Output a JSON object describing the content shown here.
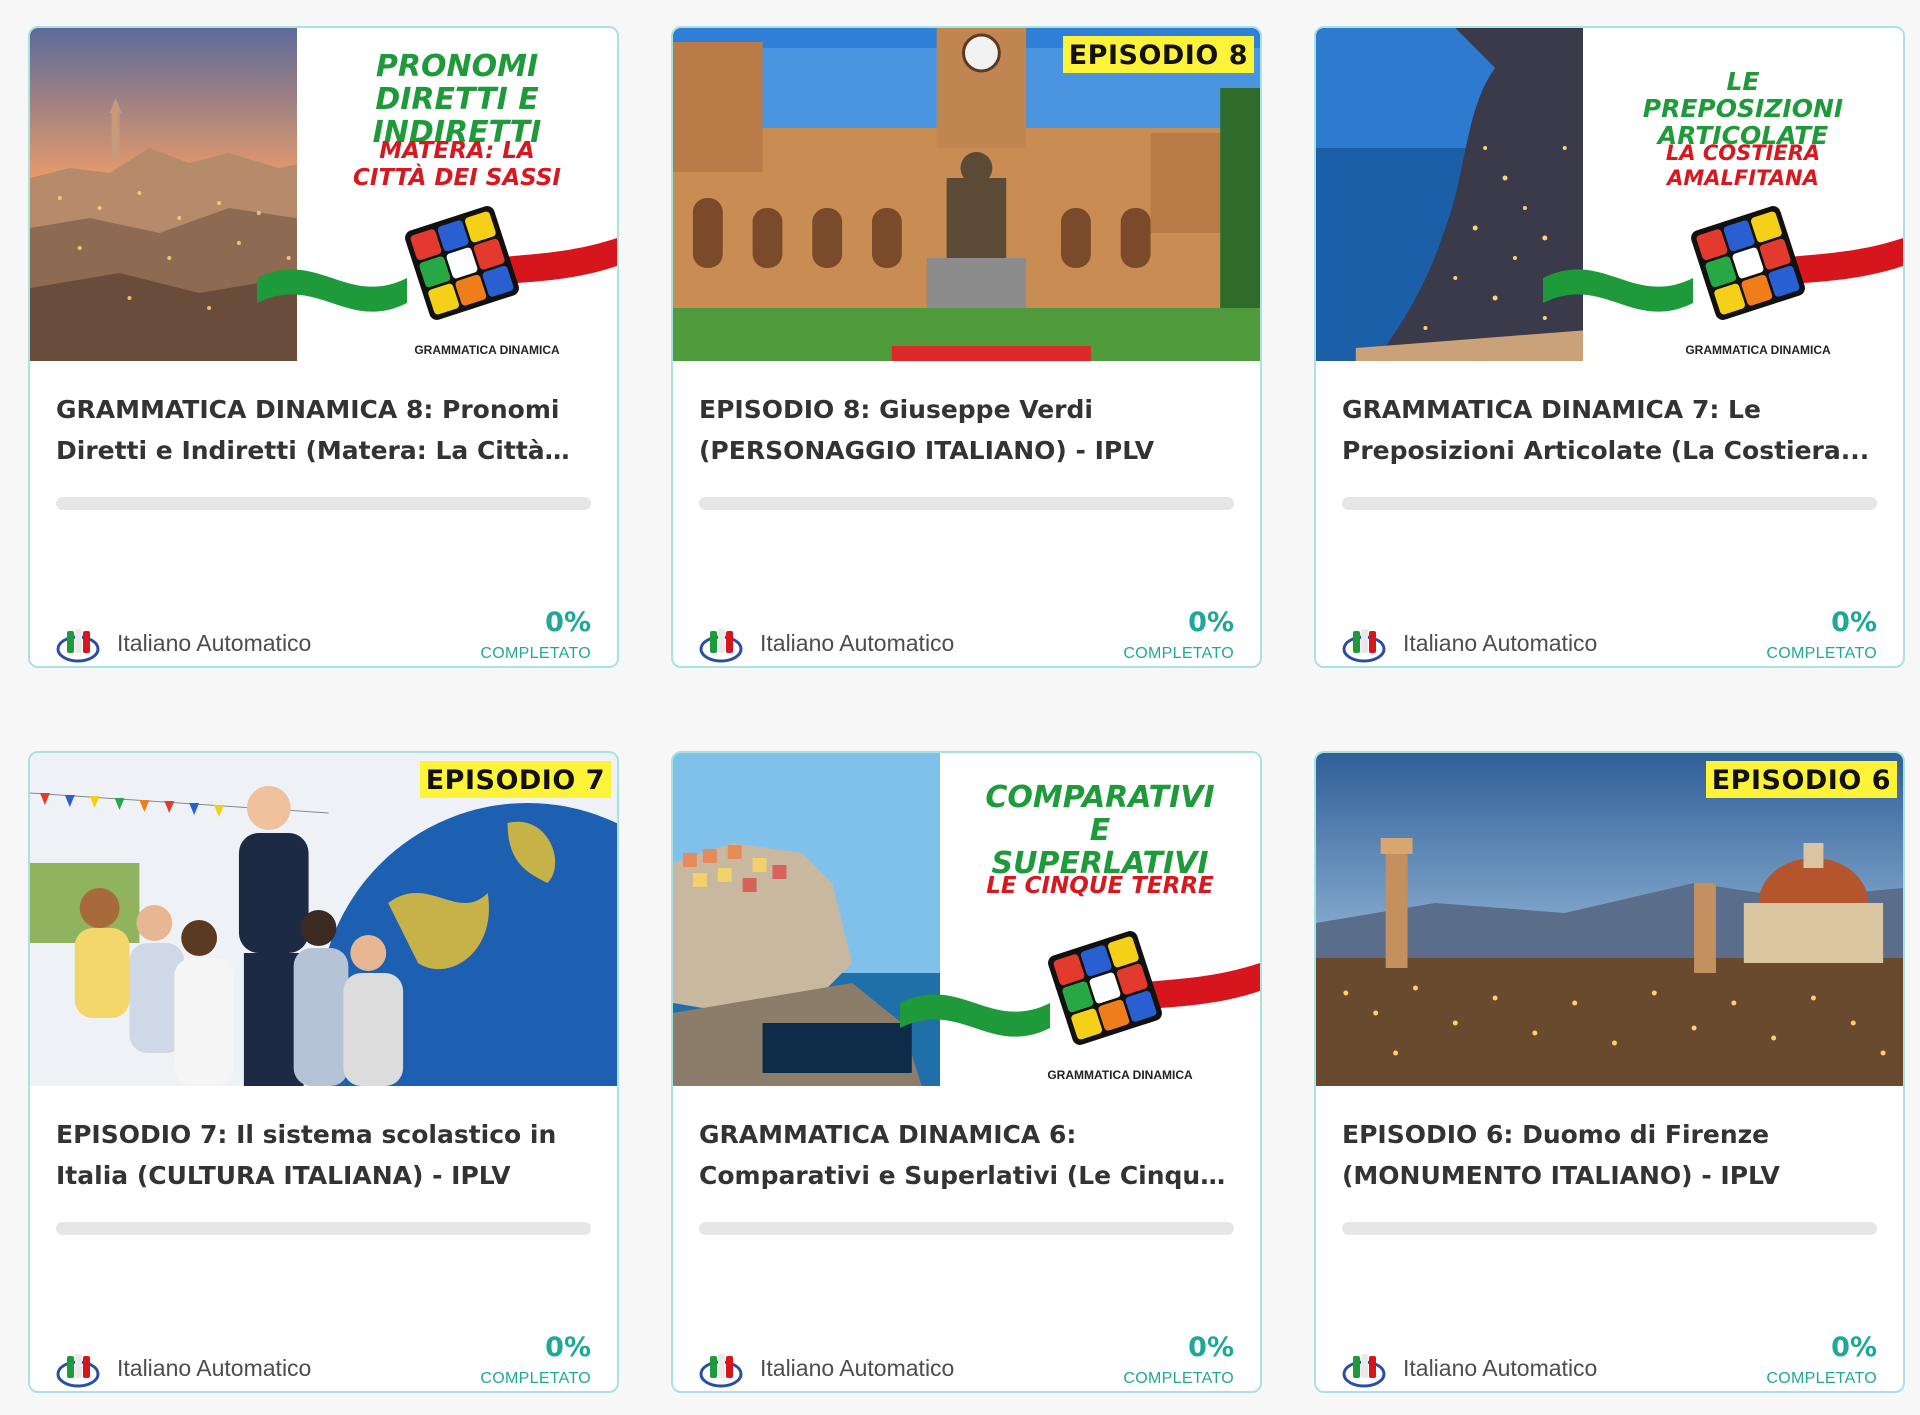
{
  "colors": {
    "accent": "#1fa89a",
    "card_border": "#a9e3df",
    "badge": "#fff33a",
    "gd_green": "#1f9a3a",
    "gd_red": "#d8171e"
  },
  "courses": [
    {
      "title": "GRAMMATICA DINAMICA 8: Pronomi Diretti e Indiretti (Matera: La Città Dei Sassi)",
      "title_display": "GRAMMATICA DINAMICA 8: Pronomi Diretti e Indiretti (Matera: La Città Dei...",
      "thumbnail": {
        "kind": "grammatica",
        "scene": "matera-sunset",
        "heading": "PRONOMI DIRETTI E INDIRETTI",
        "subheading": "MATERA: LA CITTÀ DEI SASSI",
        "brand": "GRAMMATICA DINAMICA"
      },
      "author": "Italiano Automatico",
      "progress": 0,
      "progress_text": "0%",
      "progress_label": "COMPLETATO"
    },
    {
      "title": "EPISODIO 8: Giuseppe Verdi (PERSONAGGIO ITALIANO) - IPLV",
      "title_display": "EPISODIO 8: Giuseppe Verdi (PERSONAGGIO ITALIANO) - IPLV",
      "thumbnail": {
        "kind": "episode",
        "scene": "verdi-palace",
        "badge": "EPISODIO 8"
      },
      "author": "Italiano Automatico",
      "progress": 0,
      "progress_text": "0%",
      "progress_label": "COMPLETATO"
    },
    {
      "title": "GRAMMATICA DINAMICA 7: Le Preposizioni Articolate (La Costiera Amalfitana)",
      "title_display": "GRAMMATICA DINAMICA 7: Le Preposizioni Articolate (La Costiera...",
      "thumbnail": {
        "kind": "grammatica",
        "scene": "amalfi-night",
        "heading": "LE PREPOSIZIONI ARTICOLATE",
        "subheading": "LA COSTIERA AMALFITANA",
        "brand": "GRAMMATICA DINAMICA"
      },
      "author": "Italiano Automatico",
      "progress": 0,
      "progress_text": "0%",
      "progress_label": "COMPLETATO"
    },
    {
      "title": "EPISODIO 7: Il sistema scolastico in Italia (CULTURA ITALIANA) - IPLV",
      "title_display": "EPISODIO 7: Il sistema scolastico in Italia (CULTURA ITALIANA) - IPLV",
      "thumbnail": {
        "kind": "episode",
        "scene": "classroom-globe",
        "badge": "EPISODIO 7"
      },
      "author": "Italiano Automatico",
      "progress": 0,
      "progress_text": "0%",
      "progress_label": "COMPLETATO"
    },
    {
      "title": "GRAMMATICA DINAMICA 6: Comparativi e Superlativi (Le Cinque Terre) - IPLV",
      "title_display": "GRAMMATICA DINAMICA 6: Comparativi e Superlativi (Le Cinque Terre) - IPLV",
      "thumbnail": {
        "kind": "grammatica",
        "scene": "cinque-terre",
        "heading": "COMPARATIVI E SUPERLATIVI",
        "subheading": "LE CINQUE TERRE",
        "brand": "GRAMMATICA DINAMICA"
      },
      "author": "Italiano Automatico",
      "progress": 0,
      "progress_text": "0%",
      "progress_label": "COMPLETATO"
    },
    {
      "title": "EPISODIO 6: Duomo di Firenze (MONUMENTO ITALIANO) - IPLV",
      "title_display": "EPISODIO 6: Duomo di Firenze (MONUMENTO ITALIANO) - IPLV",
      "thumbnail": {
        "kind": "episode",
        "scene": "florence-dusk",
        "badge": "EPISODIO 6"
      },
      "author": "Italiano Automatico",
      "progress": 0,
      "progress_text": "0%",
      "progress_label": "COMPLETATO"
    }
  ]
}
